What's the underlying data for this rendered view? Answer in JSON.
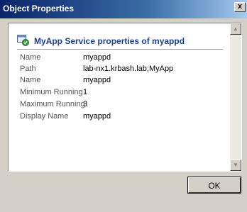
{
  "window": {
    "title": "Object Properties",
    "close_glyph": "x"
  },
  "panel": {
    "header_title": "MyApp Service properties of myappd",
    "header_icon": "service-check-icon",
    "properties": [
      {
        "label": "Name",
        "value": "myappd"
      },
      {
        "label": "Path",
        "value": "lab-nx1.krbash.lab;MyApp"
      },
      {
        "label": "Name",
        "value": "myappd"
      },
      {
        "label": "Minimum Running",
        "value": "1"
      },
      {
        "label": "Maximum Running",
        "value": "3"
      },
      {
        "label": "Display Name",
        "value": "myappd"
      }
    ]
  },
  "buttons": {
    "ok_label": "OK"
  },
  "colors": {
    "titlebar_start": "#0a246a",
    "header_text": "#1f3f8f",
    "dialog_bg": "#d4d0c8"
  }
}
